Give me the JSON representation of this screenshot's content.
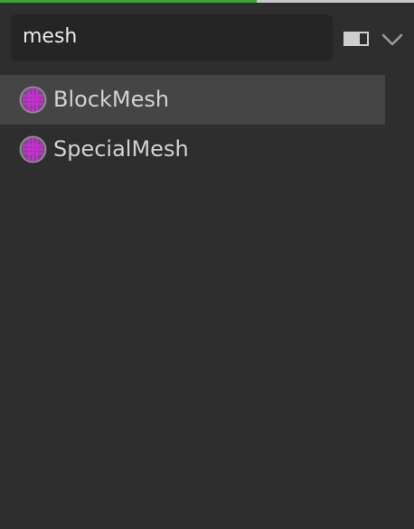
{
  "search": {
    "value": "mesh",
    "progress": 0.62
  },
  "results": [
    {
      "label": "BlockMesh",
      "icon": "mesh-class-icon",
      "selected": true
    },
    {
      "label": "SpecialMesh",
      "icon": "mesh-class-icon",
      "selected": false
    }
  ],
  "colors": {
    "progress": "#3fa33a",
    "icon": "#c020c8",
    "selected_row": "#454545"
  }
}
